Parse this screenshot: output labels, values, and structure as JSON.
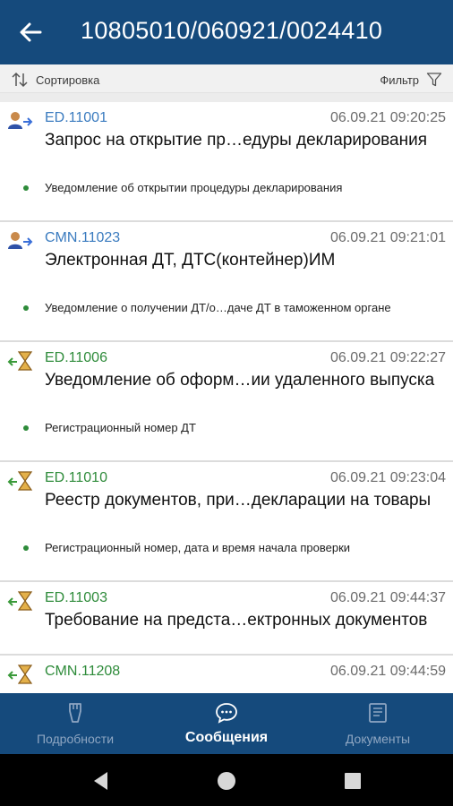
{
  "header": {
    "title": "10805010/060921/0024410",
    "colors": {
      "bar": "#154a7c"
    }
  },
  "toolbar": {
    "sort_label": "Сортировка",
    "filter_label": "Фильтр"
  },
  "messages": [
    {
      "code": "ED.11001",
      "code_color": "blue",
      "icon": "person-arrow-icon",
      "time": "06.09.21 09:20:25",
      "title": "Запрос на открытие пр…едуры декларирования",
      "subtitle": "Уведомление об открытии процедуры декларирования"
    },
    {
      "code": "CMN.11023",
      "code_color": "blue",
      "icon": "person-arrow-icon",
      "time": "06.09.21 09:21:01",
      "title": "Электронная ДТ, ДТС(контейнер)ИМ",
      "subtitle": "Уведомление о получении ДТ/о…даче ДТ в таможенном органе"
    },
    {
      "code": "ED.11006",
      "code_color": "green",
      "icon": "hourglass-arrow-icon",
      "time": "06.09.21 09:22:27",
      "title": "Уведомление об оформ…ии удаленного выпуска",
      "subtitle": "Регистрационный номер ДТ"
    },
    {
      "code": "ED.11010",
      "code_color": "green",
      "icon": "hourglass-arrow-icon",
      "time": "06.09.21 09:23:04",
      "title": "Реестр документов, при…декларации на товары",
      "subtitle": "Регистрационный номер, дата и время начала проверки"
    },
    {
      "code": "ED.11003",
      "code_color": "green",
      "icon": "hourglass-arrow-icon",
      "time": "06.09.21 09:44:37",
      "title": "Требование на предста…ектронных документов",
      "subtitle": ""
    },
    {
      "code": "CMN.11208",
      "code_color": "green",
      "icon": "hourglass-arrow-icon",
      "time": "06.09.21 09:44:59",
      "title": "",
      "subtitle": ""
    }
  ],
  "bottom_nav": {
    "tabs": [
      {
        "label": "Подробности",
        "icon": "details-icon",
        "active": false
      },
      {
        "label": "Сообщения",
        "icon": "messages-icon",
        "active": true
      },
      {
        "label": "Документы",
        "icon": "documents-icon",
        "active": false
      }
    ]
  },
  "system_nav": [
    "back-triangle-icon",
    "home-circle-icon",
    "recents-square-icon"
  ]
}
